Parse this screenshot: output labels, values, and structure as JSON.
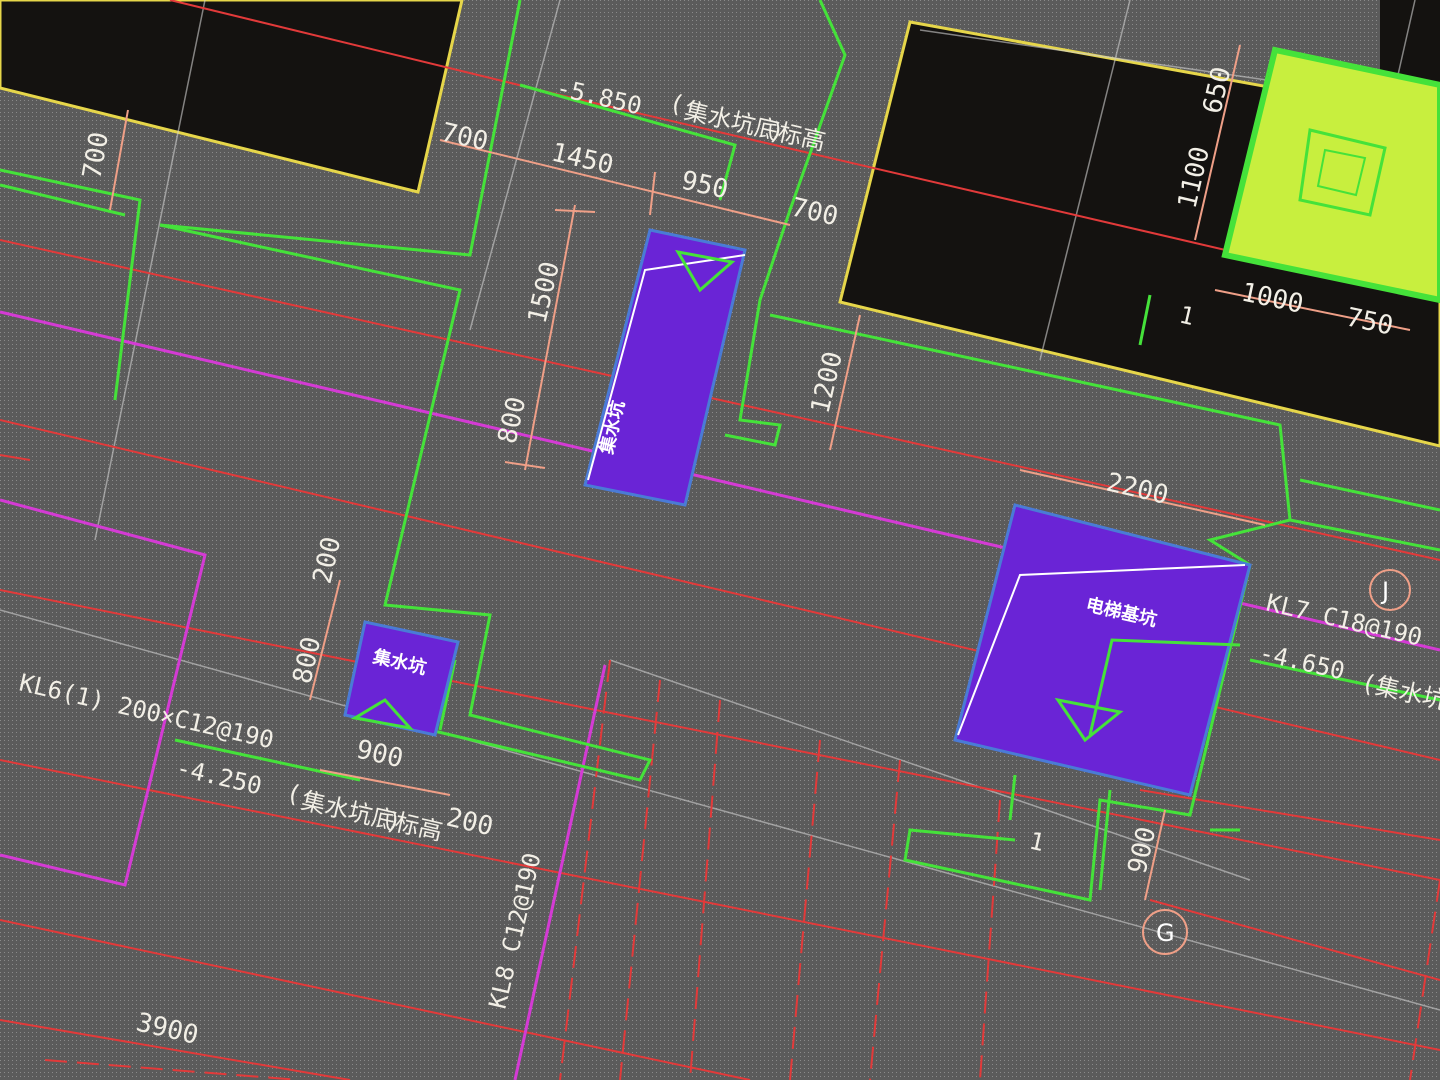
{
  "colors": {
    "slab": "#5b5b5b",
    "void": "#141210",
    "slab_edge": "#e6d64a",
    "green": "#45e23a",
    "red": "#e23a3a",
    "magenta": "#d43bd4",
    "pit": "#6a24d6",
    "pit_edge": "#4a7bd6",
    "pit_box": "#c8ef3e",
    "dim": "#ef9f87",
    "grid": "#cfcfcf",
    "text": "#f2efe6"
  },
  "dimensions": [
    "700",
    "700",
    "1450",
    "950",
    "700",
    "1500",
    "800",
    "1200",
    "650",
    "1100",
    "1000",
    "750",
    "2200",
    "200",
    "800",
    "900",
    "200",
    "900",
    "3900"
  ],
  "elevations": [
    {
      "value": "-5.850",
      "note_open": "(",
      "note": "集水坑底标高",
      "note_close": ")"
    },
    {
      "value": "-4.250",
      "note_open": "(",
      "note": "集水坑底标高",
      "note_close": ")"
    },
    {
      "value": "-4.650",
      "note": "(集水坑底标高"
    }
  ],
  "pits": [
    {
      "label": "集水坑"
    },
    {
      "label": "集水坑"
    },
    {
      "label": "电梯基坑"
    }
  ],
  "beam_labels": [
    "KL6(1) 200×C12@190",
    "KL7 C18@190",
    "KL8 C12@190"
  ],
  "section_marks": [
    "1",
    "1"
  ],
  "axes": [
    "J",
    "G"
  ]
}
